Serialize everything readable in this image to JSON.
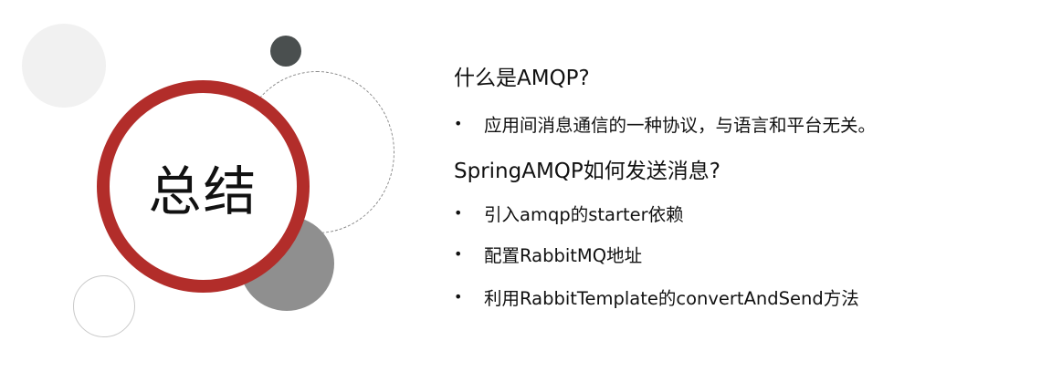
{
  "slide": {
    "title": "总结",
    "bullet_symbol": "•",
    "sections": [
      {
        "heading": "什么是AMQP?",
        "bullets": [
          "应用间消息通信的一种协议，与语言和平台无关。"
        ]
      },
      {
        "heading": "SpringAMQP如何发送消息?",
        "bullets": [
          "引入amqp的starter依赖",
          "配置RabbitMQ地址",
          "利用RabbitTemplate的convertAndSend方法"
        ]
      }
    ],
    "colors": {
      "accent_ring": "#b22d2a",
      "dark_dot": "#4a4f4f",
      "gray_circle": "#8f8f8f",
      "light_circle": "#f1f1f1"
    }
  }
}
